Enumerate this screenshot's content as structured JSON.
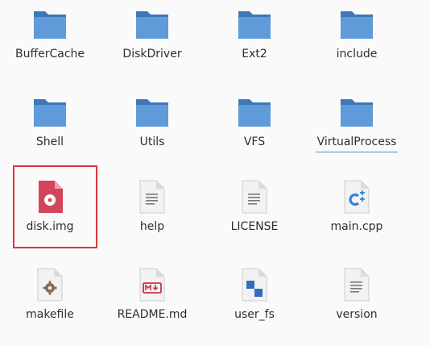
{
  "files": [
    {
      "name": "BufferCache",
      "icon": "folder-icon"
    },
    {
      "name": "DiskDriver",
      "icon": "folder-icon"
    },
    {
      "name": "Ext2",
      "icon": "folder-icon"
    },
    {
      "name": "include",
      "icon": "folder-icon"
    },
    {
      "name": "Shell",
      "icon": "folder-icon"
    },
    {
      "name": "Utils",
      "icon": "folder-icon"
    },
    {
      "name": "VFS",
      "icon": "folder-icon"
    },
    {
      "name": "VirtualProcess",
      "icon": "folder-icon"
    },
    {
      "name": "disk.img",
      "icon": "disk-image-icon"
    },
    {
      "name": "help",
      "icon": "text-file-icon"
    },
    {
      "name": "LICENSE",
      "icon": "text-file-icon"
    },
    {
      "name": "main.cpp",
      "icon": "cpp-file-icon"
    },
    {
      "name": "makefile",
      "icon": "makefile-icon"
    },
    {
      "name": "README.md",
      "icon": "markdown-file-icon"
    },
    {
      "name": "user_fs",
      "icon": "executable-file-icon"
    },
    {
      "name": "version",
      "icon": "text-file-icon"
    }
  ],
  "colors": {
    "folder": "#4a86c8",
    "folder_front": "#5e9bd8",
    "disk_image": "#d3455b",
    "selection_outline": "#d9363e",
    "rename_underline": "#3d9ac7"
  }
}
